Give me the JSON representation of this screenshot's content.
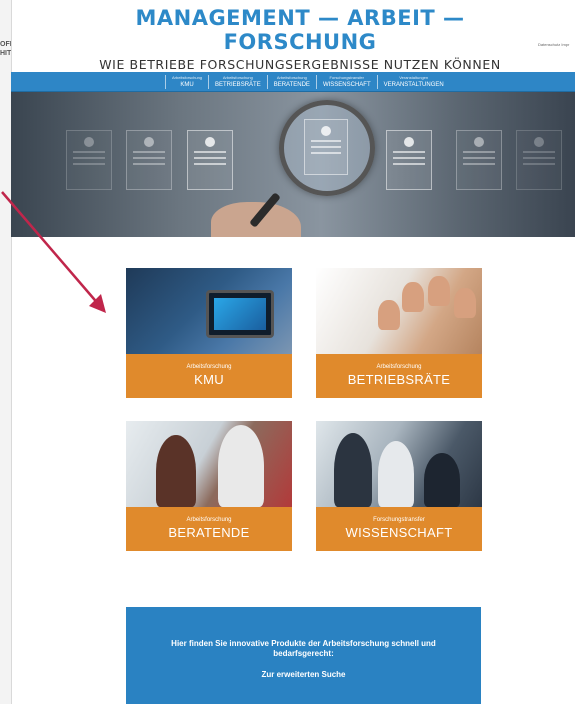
{
  "header": {
    "title": "MANAGEMENT — ARBEIT — FORSCHUNG",
    "subtitle": "WIE BETRIEBE FORSCHUNGSERGEBNISSE NUTZEN KÖNNEN",
    "left_logo_lines": [
      "OFFE",
      "HITTE"
    ],
    "top_right_links": "Datenschutz  Impr"
  },
  "nav": {
    "items": [
      {
        "small": "Arbeitsforschung",
        "label": "KMU"
      },
      {
        "small": "Arbeitsforschung",
        "label": "BETRIEBSRÄTE"
      },
      {
        "small": "Arbeitsforschung",
        "label": "BERATENDE"
      },
      {
        "small": "Forschungstransfer",
        "label": "WISSENSCHAFT"
      },
      {
        "small": "Veranstaltungen",
        "label": "VERANSTALTUNGEN"
      }
    ]
  },
  "tiles": {
    "kmu": {
      "category": "Arbeitsforschung",
      "name": "KMU"
    },
    "betriebsraete": {
      "category": "Arbeitsforschung",
      "name": "BETRIEBSRÄTE"
    },
    "beratende": {
      "category": "Arbeitsforschung",
      "name": "BERATENDE"
    },
    "wissenschaft": {
      "category": "Forschungstransfer",
      "name": "WISSENSCHAFT"
    }
  },
  "cta": {
    "text": "Hier finden Sie innovative Produkte der Arbeitsforschung schnell und bedarfsgerecht:",
    "link": "Zur erweiterten Suche"
  },
  "colors": {
    "brand_blue": "#2d89c8",
    "nav_blue": "#2e86c6",
    "tile_orange": "#e08a2c",
    "arrow": "#c0264b"
  }
}
